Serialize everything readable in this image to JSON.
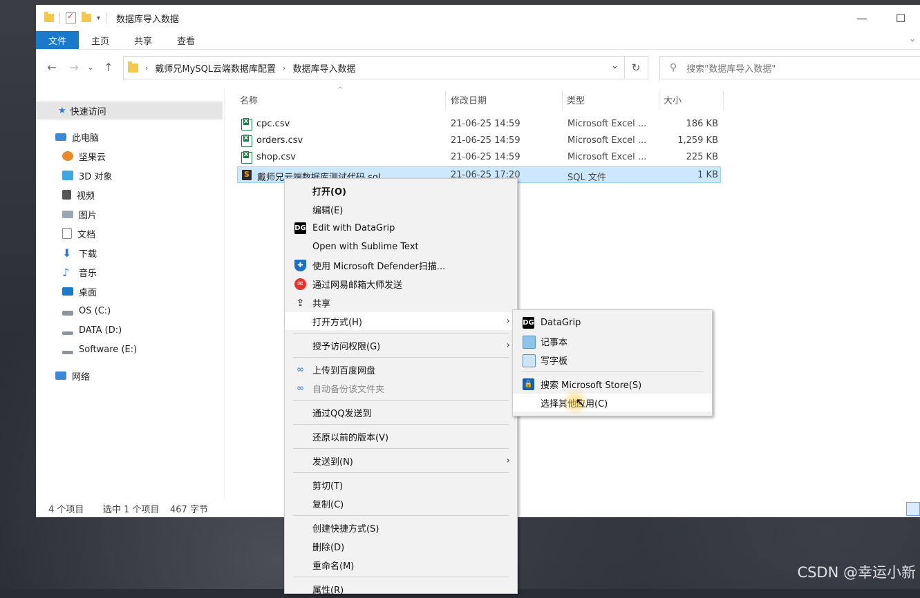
{
  "window": {
    "title": "数据库导入数据",
    "controls": {
      "minimize": "—",
      "maximize": "☐"
    }
  },
  "ribbon": {
    "tabs": [
      "文件",
      "主页",
      "共享",
      "查看"
    ]
  },
  "address": {
    "crumbs": [
      "戴师兄MySQL云端数据库配置",
      "数据库导入数据"
    ],
    "search_placeholder": "搜索\"数据库导入数据\""
  },
  "navpane": {
    "items": [
      {
        "label": "快速访问",
        "icon": "star-icon"
      },
      {
        "label": "此电脑",
        "icon": "computer-icon"
      },
      {
        "label": "坚果云",
        "icon": "nutstore-icon"
      },
      {
        "label": "3D 对象",
        "icon": "3d-objects-icon"
      },
      {
        "label": "视频",
        "icon": "video-icon"
      },
      {
        "label": "图片",
        "icon": "pictures-icon"
      },
      {
        "label": "文档",
        "icon": "documents-icon"
      },
      {
        "label": "下载",
        "icon": "download-icon"
      },
      {
        "label": "音乐",
        "icon": "music-icon"
      },
      {
        "label": "桌面",
        "icon": "desktop-icon"
      },
      {
        "label": "OS (C:)",
        "icon": "drive-icon"
      },
      {
        "label": "DATA (D:)",
        "icon": "drive-icon"
      },
      {
        "label": "Software (E:)",
        "icon": "drive-icon"
      },
      {
        "label": "网络",
        "icon": "network-icon"
      }
    ]
  },
  "columns": [
    "名称",
    "修改日期",
    "类型",
    "大小"
  ],
  "files": [
    {
      "name": "cpc.csv",
      "date": "21-06-25 14:59",
      "type": "Microsoft Excel ...",
      "size": "186 KB",
      "icon": "excel-icon"
    },
    {
      "name": "orders.csv",
      "date": "21-06-25 14:59",
      "type": "Microsoft Excel ...",
      "size": "1,259 KB",
      "icon": "excel-icon"
    },
    {
      "name": "shop.csv",
      "date": "21-06-25 14:59",
      "type": "Microsoft Excel ...",
      "size": "225 KB",
      "icon": "excel-icon"
    },
    {
      "name": "戴师兄云端数据库测试代码.sql",
      "date": "21-06-25 17:20",
      "type": "SQL 文件",
      "size": "1 KB",
      "icon": "sublime-icon"
    }
  ],
  "status": {
    "count": "4 个项目",
    "selection": "选中 1 个项目",
    "bytes": "467 字节"
  },
  "context_menu": {
    "items": [
      {
        "label": "打开(O)"
      },
      {
        "label": "编辑(E)"
      },
      {
        "label": "Edit with DataGrip",
        "icon": "datagrip-icon"
      },
      {
        "label": "Open with Sublime Text"
      },
      {
        "label": "使用 Microsoft Defender扫描...",
        "icon": "defender-icon"
      },
      {
        "label": "通过网易邮箱大师发送",
        "icon": "netease-mail-icon"
      },
      {
        "label": "共享",
        "icon": "share-icon"
      },
      {
        "label": "打开方式(H)"
      },
      {
        "label": "授予访问权限(G)"
      },
      {
        "label": "上传到百度网盘",
        "icon": "baidu-netdisk-icon"
      },
      {
        "label": "自动备份该文件夹",
        "icon": "baidu-netdisk-icon"
      },
      {
        "label": "通过QQ发送到"
      },
      {
        "label": "还原以前的版本(V)"
      },
      {
        "label": "发送到(N)"
      },
      {
        "label": "剪切(T)"
      },
      {
        "label": "复制(C)"
      },
      {
        "label": "创建快捷方式(S)"
      },
      {
        "label": "删除(D)"
      },
      {
        "label": "重命名(M)"
      },
      {
        "label": "属性(R)"
      }
    ]
  },
  "open_with_menu": {
    "items": [
      {
        "label": "DataGrip",
        "icon": "datagrip-icon"
      },
      {
        "label": "记事本",
        "icon": "notepad-icon"
      },
      {
        "label": "写字板",
        "icon": "wordpad-icon"
      },
      {
        "label": "搜索 Microsoft Store(S)",
        "icon": "store-icon"
      },
      {
        "label": "选择其他应用(C)"
      }
    ]
  },
  "watermark": "CSDN @幸运小新",
  "colors": {
    "accent": "#1979ca",
    "selection": "#cce8ff",
    "menu_bg": "#f2f2f2"
  }
}
